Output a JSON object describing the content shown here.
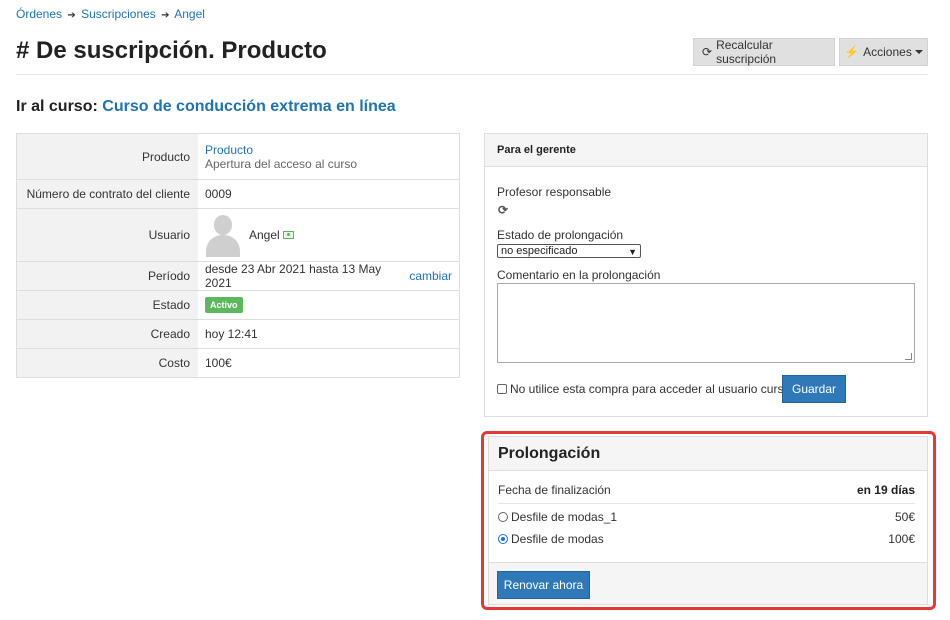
{
  "breadcrumb": {
    "items": [
      "Órdenes",
      "Suscripciones",
      "Angel"
    ],
    "sep": "➔"
  },
  "page": {
    "title": "# De suscripción. Producto"
  },
  "toolbar": {
    "recalc_icon": "⟳",
    "recalc_label": "Recalcular suscripción",
    "actions_icon": "⚡",
    "actions_label": "Acciones"
  },
  "course": {
    "prefix": "Ir al curso:",
    "name": "Curso de conducción extrema en línea"
  },
  "details": {
    "product_label": "Producto",
    "product_link": "Producto",
    "product_desc": "Apertura del acceso al curso",
    "contract_label": "Número de contrato del cliente",
    "contract_value": "0009",
    "user_label": "Usuario",
    "user_name": "Angel",
    "period_label": "Período",
    "period_value": "desde 23 Abr 2021 hasta 13 May 2021",
    "period_change": "cambiar",
    "status_label": "Estado",
    "status_value": "Activo",
    "created_label": "Creado",
    "created_value": "hoy 12:41",
    "cost_label": "Costo",
    "cost_value": "100€"
  },
  "manager": {
    "title": "Para el gerente",
    "teacher_label": "Profesor responsable",
    "prolong_status_label": "Estado de prolongación",
    "prolong_status_value": "no especificado",
    "comment_label": "Comentario en la prolongación",
    "checkbox_label": "No utilice esta compra para acceder al usuario cursante",
    "save_label": "Guardar"
  },
  "prolongation": {
    "title": "Prolongación",
    "end_label": "Fecha de finalización",
    "end_value": "en 19 días",
    "options": [
      {
        "label": "Desfile de modas_1",
        "price": "50€",
        "selected": false
      },
      {
        "label": "Desfile de modas",
        "price": "100€",
        "selected": true
      }
    ],
    "renew_label": "Renovar ahora"
  },
  "colors": {
    "link": "#1e73b7",
    "primary_button": "#2f79b9",
    "success": "#5cb85c",
    "highlight": "#e53935"
  }
}
